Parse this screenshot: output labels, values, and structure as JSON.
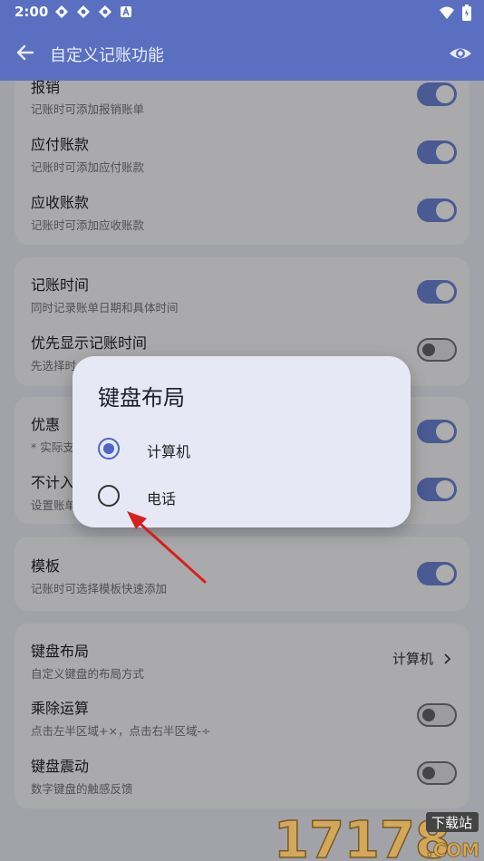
{
  "status": {
    "time": "2:00"
  },
  "appbar": {
    "title": "自定义记账功能"
  },
  "groups": [
    {
      "rows": [
        {
          "title": "报销",
          "sub": "记账时可添加报销账单",
          "toggle": "on"
        },
        {
          "title": "应付账款",
          "sub": "记账时可添加应付账款",
          "toggle": "on"
        },
        {
          "title": "应收账款",
          "sub": "记账时可添加应收账款",
          "toggle": "on"
        }
      ]
    },
    {
      "rows": [
        {
          "title": "记账时间",
          "sub": "同时记录账单日期和具体时间",
          "toggle": "on"
        },
        {
          "title": "优先显示记账时间",
          "sub": "先选择时",
          "toggle": "off"
        }
      ]
    },
    {
      "rows": [
        {
          "title": "优惠",
          "sub": "* 实际支",
          "toggle": "on"
        },
        {
          "title": "不计入",
          "sub": "设置账单",
          "toggle": "on"
        }
      ]
    },
    {
      "rows": [
        {
          "title": "模板",
          "sub": "记账时可选择模板快速添加",
          "toggle": "on"
        }
      ]
    },
    {
      "rows": [
        {
          "title": "键盘布局",
          "sub": "自定义键盘的布局方式",
          "value": "计算机"
        },
        {
          "title": "乘除运算",
          "sub": "点击左半区域+×，点击右半区域-÷",
          "toggle": "off"
        },
        {
          "title": "键盘震动",
          "sub": "数字键盘的触感反馈",
          "toggle": "off"
        }
      ]
    }
  ],
  "dialog": {
    "title": "键盘布局",
    "options": [
      {
        "label": "计算机",
        "checked": true
      },
      {
        "label": "电话",
        "checked": false
      }
    ]
  },
  "watermark": {
    "text": "17178",
    "domain": ".COM",
    "tag": "下载站"
  },
  "colors": {
    "primary": "#5a6fc0",
    "accent": "#6e85d8",
    "arrow": "#d62020"
  }
}
